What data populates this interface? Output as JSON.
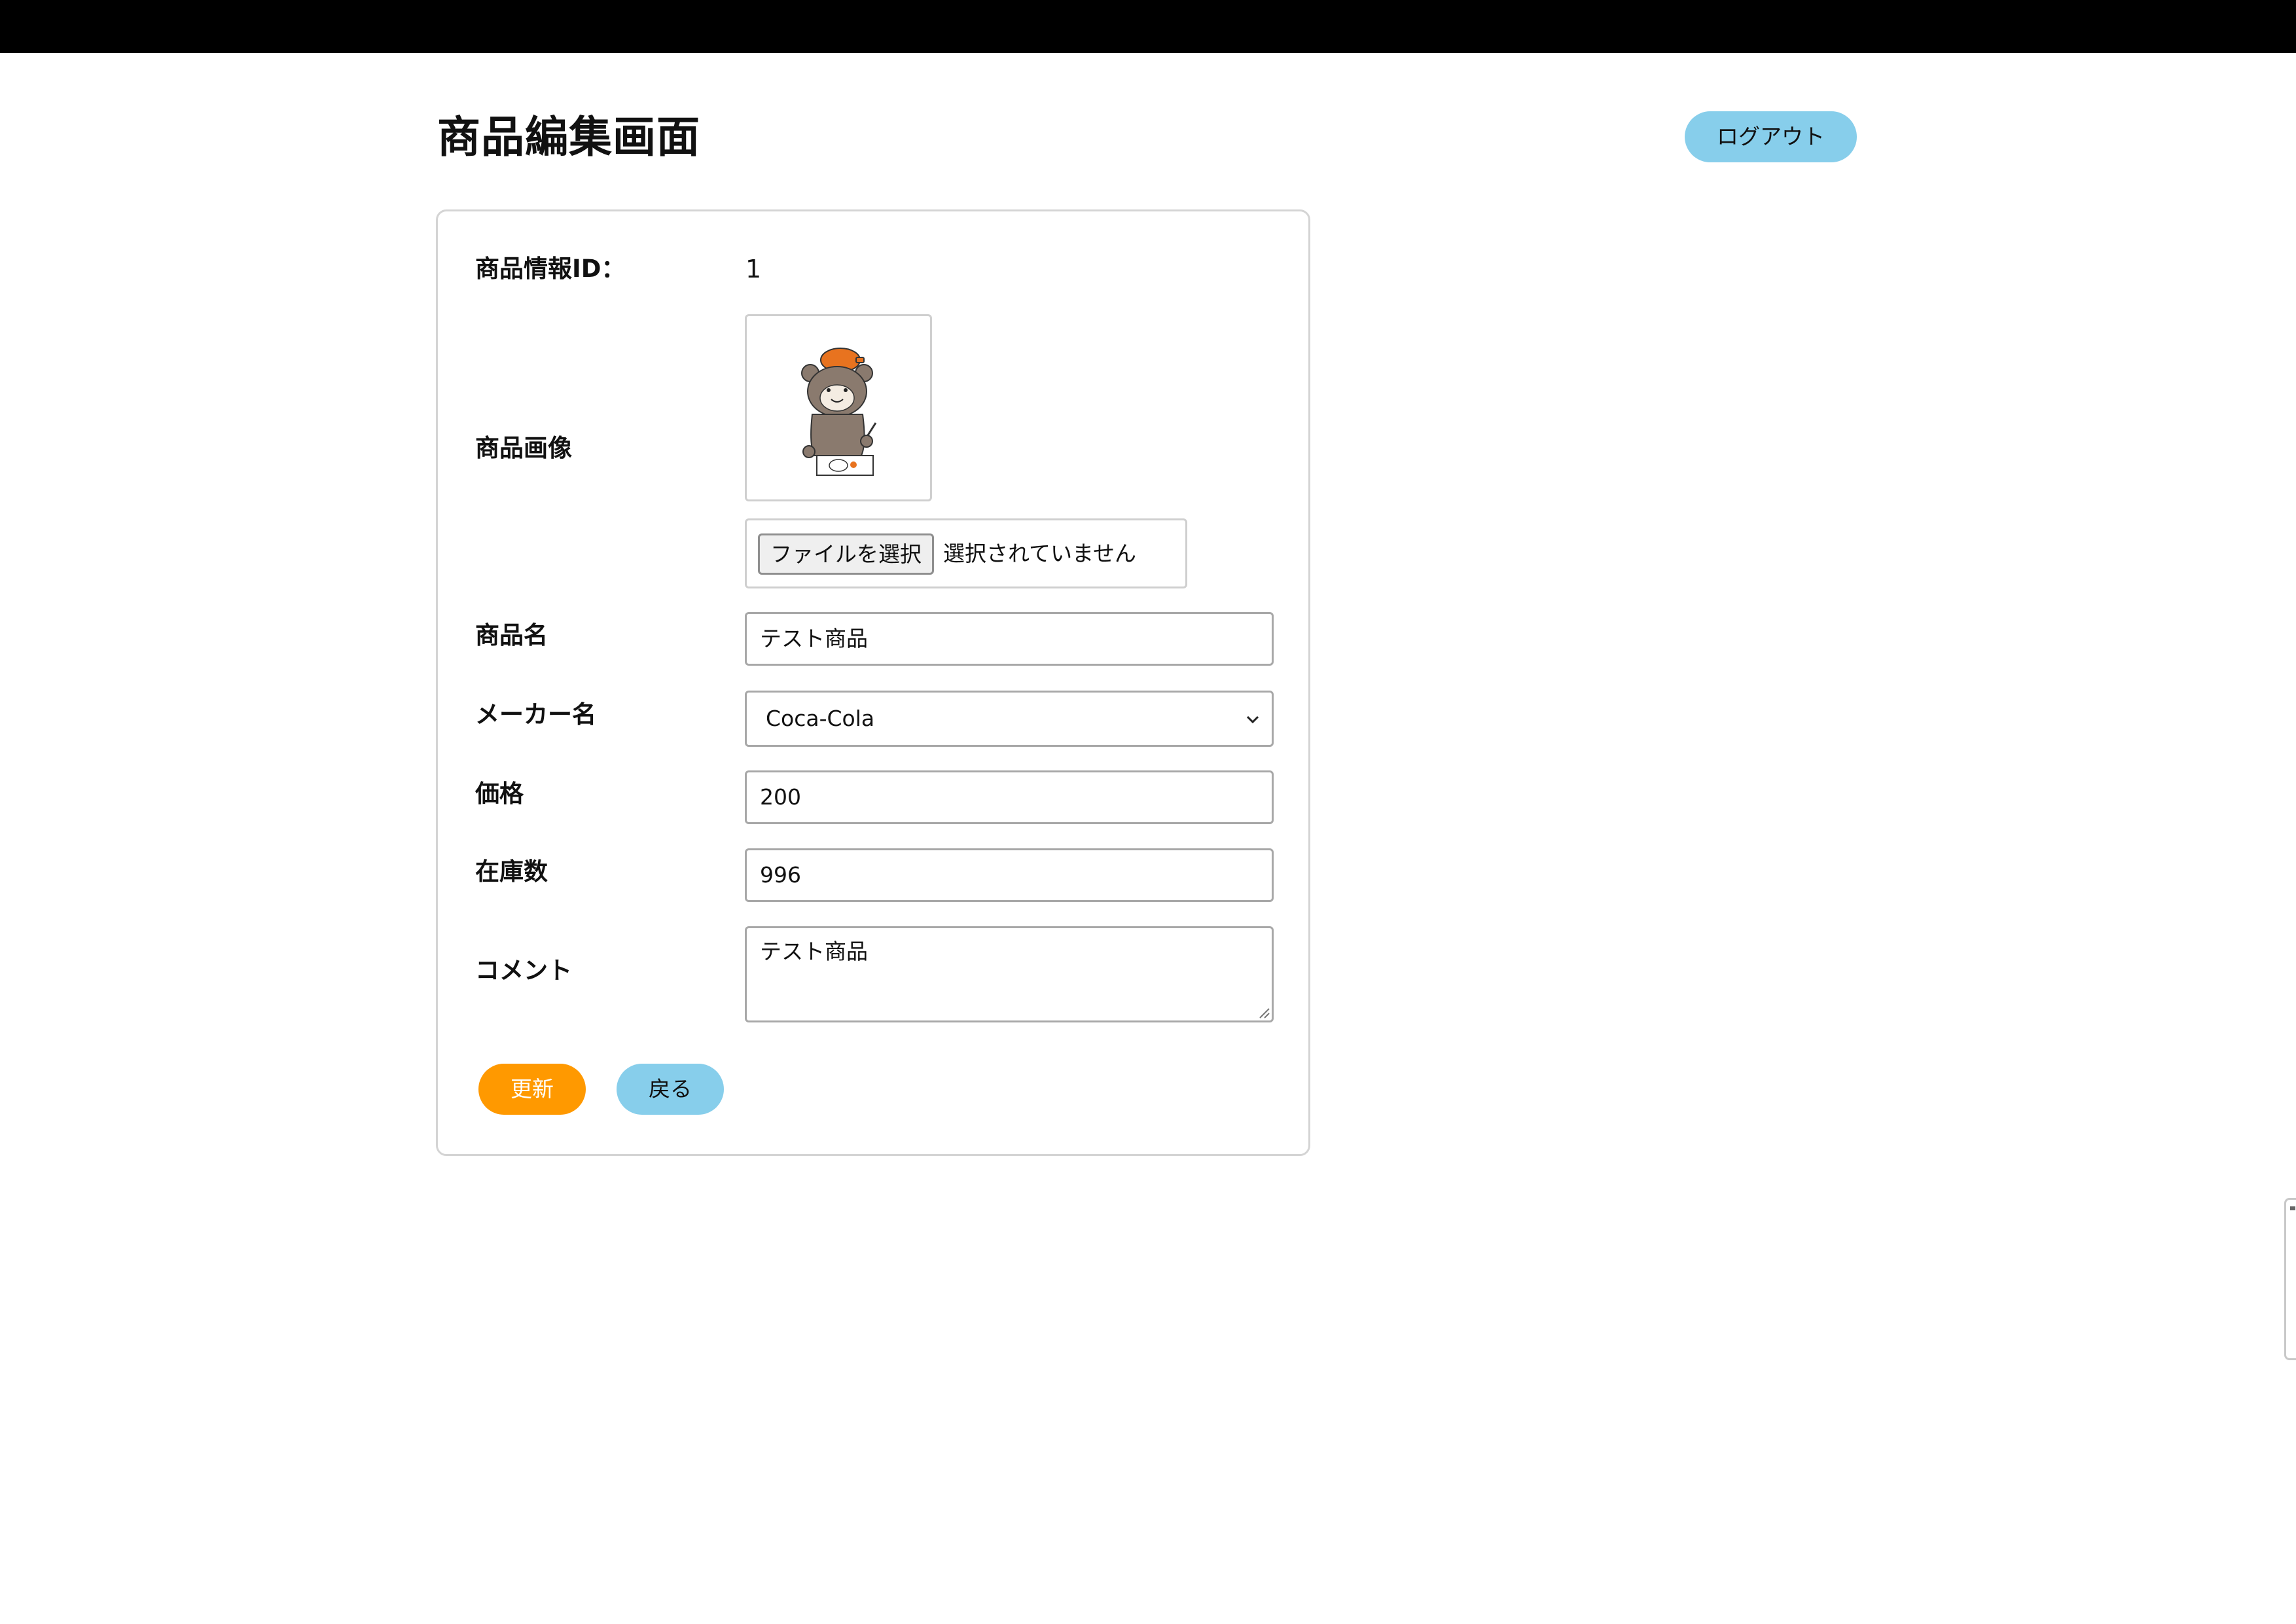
{
  "header": {
    "title": "商品編集画面",
    "logout_label": "ログアウト"
  },
  "form": {
    "id_label": "商品情報ID：",
    "id_value": "1",
    "image_label": "商品画像",
    "file_button_label": "ファイルを選択",
    "file_status": "選択されていません",
    "name_label": "商品名",
    "name_value": "テスト商品",
    "maker_label": "メーカー名",
    "maker_selected": "Coca-Cola",
    "price_label": "価格",
    "price_value": "200",
    "stock_label": "在庫数",
    "stock_value": "996",
    "comment_label": "コメント",
    "comment_value": "テスト商品",
    "update_label": "更新",
    "back_label": "戻る"
  },
  "colors": {
    "topbar": "#000000",
    "logout_button": "#87ceeb",
    "update_button": "#ff9900",
    "back_button": "#87ceeb"
  },
  "icons": {
    "product_image": "bear-drawing-illustration",
    "select_arrow": "chevron-down-icon",
    "textarea_resize": "resize-handle-icon"
  }
}
